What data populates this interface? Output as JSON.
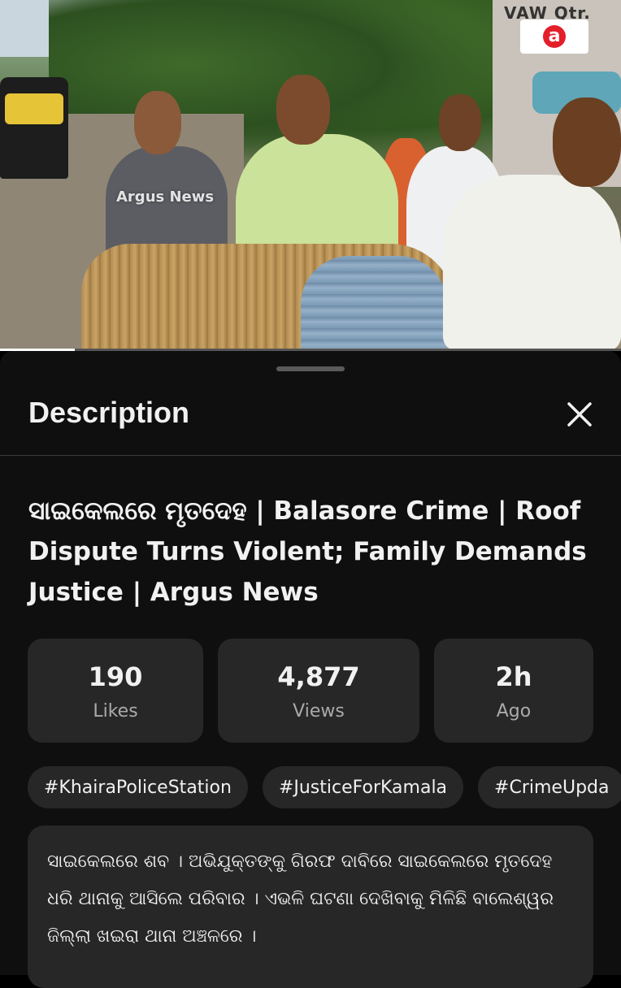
{
  "video": {
    "overlay_sign": "VAW Qtr.",
    "channel_logo_letter": "a",
    "watermark": "Argus News",
    "progress_fraction": 0.12
  },
  "sheet": {
    "title": "Description",
    "close_icon": "close-icon",
    "video_title": "ସାଇକେଲରେ ମୃତଦେହ | Balasore Crime | Roof Dispute Turns Violent; Family Demands Justice | Argus News",
    "stats": [
      {
        "value": "190",
        "label": "Likes"
      },
      {
        "value": "4,877",
        "label": "Views"
      },
      {
        "value": "2h",
        "label": "Ago"
      }
    ],
    "hashtags": [
      "#KhairaPoliceStation",
      "#JusticeForKamala",
      "#CrimeUpda"
    ],
    "description": "ସାଇକେଲରେ ଶବ । ଅଭିଯୁକ୍ତଙ୍କୁ ଗିରଫ ଦାବିରେ ସାଇକେଲରେ ମୃତଦେହ ଧରି ଥାନାକୁ ଆସିଲେ ପରିବାର । ଏଭଳି ଘଟଣା ଦେଖିବାକୁ ମିଳିଛି  ବାଲେଶ୍ୱର ଜିଲ୍ଲା ଖଇରା ଥାନା ଅଞ୍ଚଳରେ ।"
  },
  "colors": {
    "sheet_bg": "#0f0f0f",
    "card_bg": "#272727",
    "text_primary": "#f1f1f1",
    "text_secondary": "#aaaaaa",
    "brand_red": "#e41f2a"
  }
}
